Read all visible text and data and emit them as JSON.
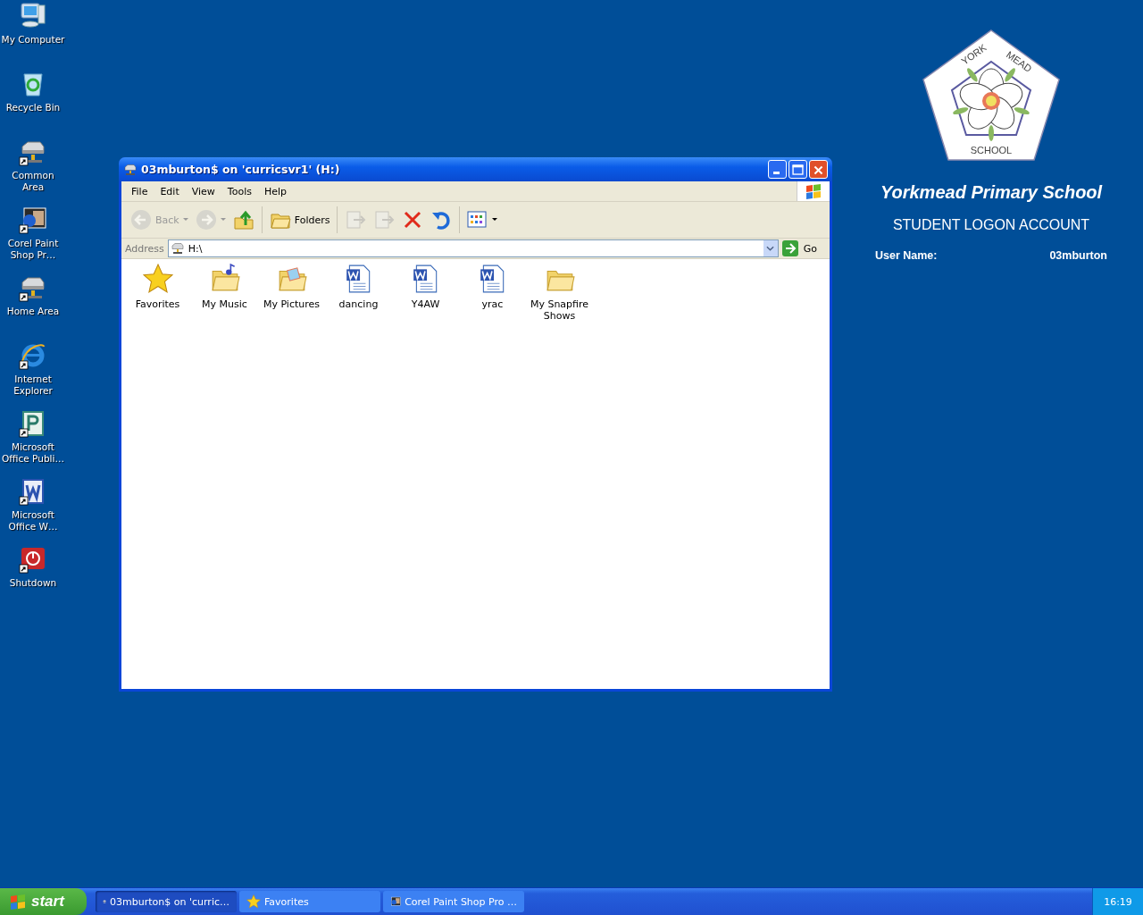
{
  "desktop_icons": [
    {
      "label": "My Computer",
      "kind": "computer",
      "shortcut": false
    },
    {
      "label": "Recycle Bin",
      "kind": "recycle",
      "shortcut": false
    },
    {
      "label": "Common Area",
      "kind": "drive",
      "shortcut": true
    },
    {
      "label": "Corel Paint Shop Pr…",
      "kind": "paint",
      "shortcut": true
    },
    {
      "label": "Home Area",
      "kind": "drive",
      "shortcut": true
    },
    {
      "label": "Internet Explorer",
      "kind": "browser",
      "shortcut": true
    },
    {
      "label": "Microsoft Office Publi…",
      "kind": "publisher",
      "shortcut": true
    },
    {
      "label": "Microsoft Office W…",
      "kind": "word",
      "shortcut": true
    },
    {
      "label": "Shutdown",
      "kind": "shutdown",
      "shortcut": true
    }
  ],
  "wallpaper": {
    "logo_top_left": "YORK",
    "logo_top_right": "MEAD",
    "logo_bottom": "SCHOOL",
    "school_name": "Yorkmead Primary School",
    "heading": "STUDENT LOGON ACCOUNT",
    "user_name_label": "User Name:",
    "user_name": "03mburton"
  },
  "window": {
    "title": "03mburton$ on 'curricsvr1' (H:)",
    "menu": [
      "File",
      "Edit",
      "View",
      "Tools",
      "Help"
    ],
    "toolbar": [
      {
        "kind": "back",
        "label": "Back",
        "disabled": true
      },
      {
        "kind": "forward",
        "disabled": true
      },
      {
        "kind": "up",
        "disabled": false
      },
      {
        "kind": "folders",
        "label": "Folders",
        "disabled": false
      },
      {
        "kind": "move",
        "disabled": true
      },
      {
        "kind": "copy",
        "disabled": true
      },
      {
        "kind": "delete",
        "disabled": false
      },
      {
        "kind": "undo",
        "disabled": false
      },
      {
        "kind": "views",
        "disabled": false
      }
    ],
    "address_label": "Address",
    "address": "H:\\",
    "go": "Go",
    "files": [
      {
        "label": "Favorites",
        "kind": "star"
      },
      {
        "label": "My Music",
        "kind": "music"
      },
      {
        "label": "My Pictures",
        "kind": "pictures"
      },
      {
        "label": "dancing",
        "kind": "doc"
      },
      {
        "label": "Y4AW",
        "kind": "doc"
      },
      {
        "label": "yrac",
        "kind": "doc"
      },
      {
        "label": "My Snapfire Shows",
        "kind": "folder"
      }
    ]
  },
  "taskbar": {
    "start": "start",
    "tasks": [
      {
        "label": "03mburton$ on 'curric…",
        "kind": "drive",
        "selected": true
      },
      {
        "label": "Favorites",
        "kind": "star",
        "selected": false
      },
      {
        "label": "Corel Paint Shop Pro …",
        "kind": "paint",
        "selected": false
      }
    ],
    "clock": "16:19"
  }
}
